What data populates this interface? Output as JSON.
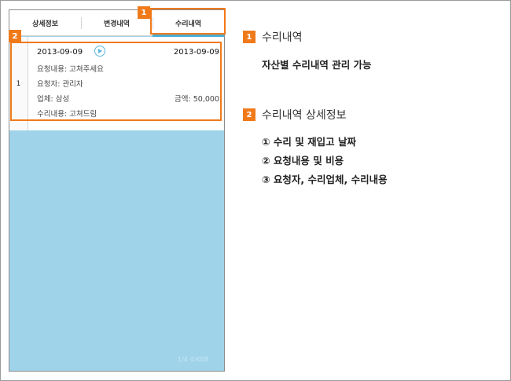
{
  "tabs": [
    {
      "label": "상세정보"
    },
    {
      "label": "변경내역"
    },
    {
      "label": "수리내역"
    }
  ],
  "active_tab": "수리내역",
  "record": {
    "row_number": "1",
    "date_left": "2013-09-09",
    "date_right": "2013-09-09",
    "request_content": "요청내용: 고쳐주세요",
    "requester": "요청자: 관리자",
    "vendor": "업체: 삼성",
    "amount": "금액: 50,000",
    "repair_content": "수리내용: 고쳐드림"
  },
  "watermark": "1/4 ©KEB",
  "markers": {
    "one": "1",
    "two": "2"
  },
  "section1": {
    "title": "수리내역",
    "description": "자산별 수리내역 관리 가능"
  },
  "section2": {
    "title": "수리내역 상세정보",
    "items": [
      "① 수리 및 재입고 날짜",
      "② 요청내용 및 비용",
      "③ 요청자, 수리업체, 수리내용"
    ]
  },
  "colors": {
    "accent": "#f07a1a",
    "tab_indicator": "#4aaed8",
    "list_background": "#9fd3ea"
  }
}
